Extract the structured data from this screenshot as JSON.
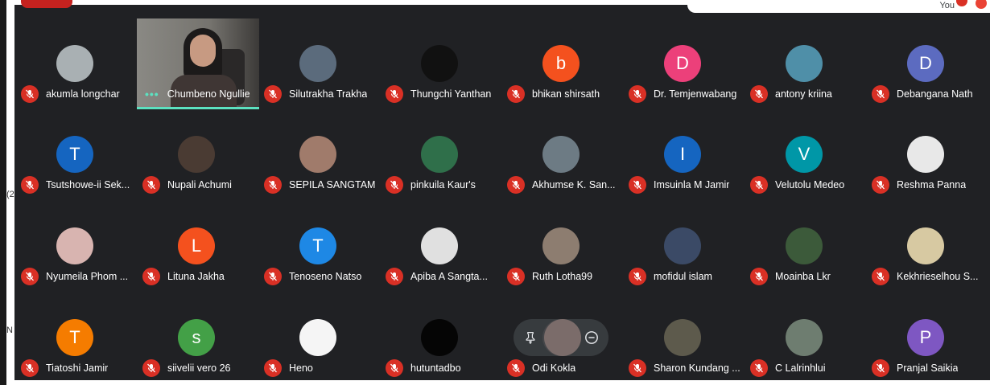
{
  "self_label": "You",
  "edge_glyphs": [
    "(2",
    "N"
  ],
  "speaking": {
    "name": "Chumbeno Ngullie",
    "indicator": "•••"
  },
  "colors": {
    "stage": "#202124",
    "mic_off": "#d93025",
    "speaking": "#5ce1c0"
  },
  "participants": [
    {
      "name": "akumla longchar",
      "initial": "",
      "color": "#a9b0b3",
      "photo": true
    },
    {
      "name": "Silutrakha Trakha",
      "initial": "",
      "color": "#5b6b7c",
      "photo": true
    },
    {
      "name": "Thungchi Yanthan",
      "initial": "",
      "color": "#111111",
      "photo": true
    },
    {
      "name": "bhikan shirsath",
      "initial": "b",
      "color": "#f4511e",
      "photo": false
    },
    {
      "name": "Dr. Temjenwabang",
      "initial": "D",
      "color": "#ec407a",
      "photo": false
    },
    {
      "name": "antony kriina",
      "initial": "",
      "color": "#4f8fa8",
      "photo": true
    },
    {
      "name": "Debangana Nath",
      "initial": "D",
      "color": "#5c6bc0",
      "photo": false
    },
    {
      "name": "Tsutshowe-ii Sek...",
      "initial": "T",
      "color": "#1565c0",
      "photo": false
    },
    {
      "name": "Nupali Achumi",
      "initial": "",
      "color": "#4a3b33",
      "photo": true
    },
    {
      "name": "SEPILA SANGTAM",
      "initial": "",
      "color": "#a07b6b",
      "photo": true
    },
    {
      "name": "pinkuila Kaur's",
      "initial": "",
      "color": "#2f6f4a",
      "photo": true
    },
    {
      "name": "Akhumse K. San...",
      "initial": "",
      "color": "#6d7b84",
      "photo": true
    },
    {
      "name": "Imsuinla M Jamir",
      "initial": "I",
      "color": "#1565c0",
      "photo": false
    },
    {
      "name": "Velutolu Medeo",
      "initial": "V",
      "color": "#0097a7",
      "photo": false
    },
    {
      "name": "Reshma Panna",
      "initial": "",
      "color": "#e8e8e8",
      "photo": true
    },
    {
      "name": "Nyumeila Phom ...",
      "initial": "",
      "color": "#d8b4b0",
      "photo": true
    },
    {
      "name": "Lituna Jakha",
      "initial": "L",
      "color": "#f4511e",
      "photo": false
    },
    {
      "name": "Tenoseno Natso",
      "initial": "T",
      "color": "#1e88e5",
      "photo": false
    },
    {
      "name": "Apiba A Sangta...",
      "initial": "",
      "color": "#e0e0e0",
      "photo": true
    },
    {
      "name": "Ruth Lotha99",
      "initial": "",
      "color": "#8d7d70",
      "photo": true
    },
    {
      "name": "mofidul islam",
      "initial": "",
      "color": "#3b4a66",
      "photo": true
    },
    {
      "name": "Moainba Lkr",
      "initial": "",
      "color": "#3c5a3a",
      "photo": true
    },
    {
      "name": "Kekhrieselhou S...",
      "initial": "",
      "color": "#d7c9a2",
      "photo": true
    },
    {
      "name": "Tiatoshi Jamir",
      "initial": "T",
      "color": "#f57c00",
      "photo": false
    },
    {
      "name": "siivelii vero 26",
      "initial": "s",
      "color": "#43a047",
      "photo": false
    },
    {
      "name": "Heno",
      "initial": "",
      "color": "#f5f5f5",
      "photo": true
    },
    {
      "name": "hutuntadbo",
      "initial": "",
      "color": "#050505",
      "photo": true
    },
    {
      "name": "Odi Kokla",
      "initial": "",
      "color": "#7b6c6a",
      "photo": true
    },
    {
      "name": "Sharon Kundang ...",
      "initial": "",
      "color": "#5d5a4c",
      "photo": true
    },
    {
      "name": "C Lalrinhlui",
      "initial": "",
      "color": "#6e7d70",
      "photo": true
    },
    {
      "name": "Pranjal Saikia",
      "initial": "P",
      "color": "#7e57c2",
      "photo": false
    }
  ]
}
